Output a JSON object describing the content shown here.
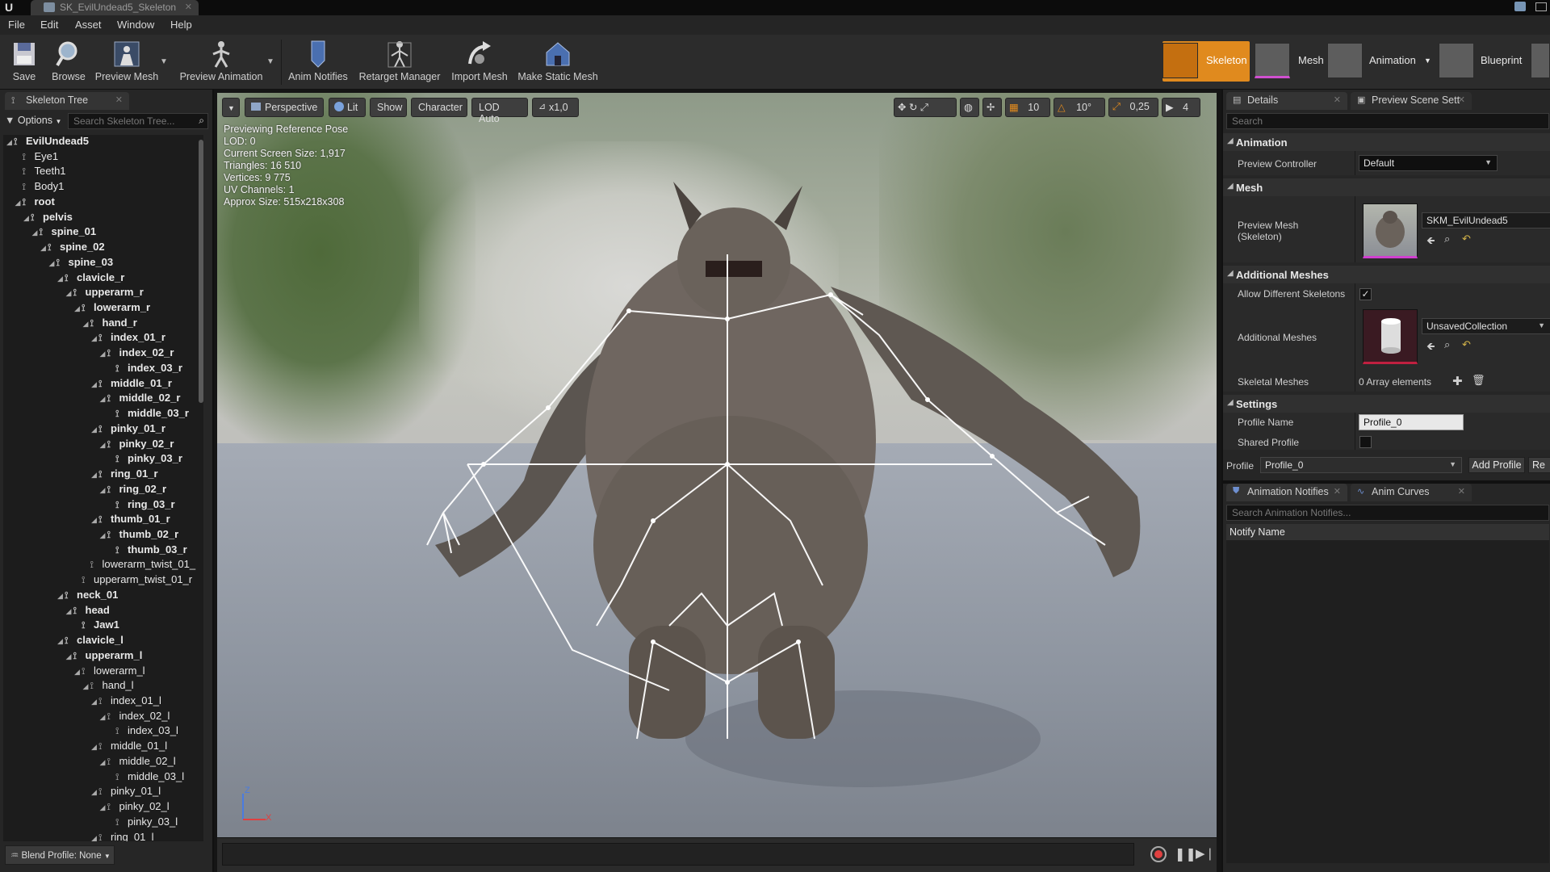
{
  "titlebar": {
    "logo": "U",
    "doc_tab": "SK_EvilUndead5_Skeleton"
  },
  "menu": [
    "File",
    "Edit",
    "Asset",
    "Window",
    "Help"
  ],
  "toolbar": {
    "save": "Save",
    "browse": "Browse",
    "preview_mesh": "Preview Mesh",
    "preview_animation": "Preview Animation",
    "anim_notifies": "Anim Notifies",
    "retarget_manager": "Retarget Manager",
    "import_mesh": "Import Mesh",
    "make_static_mesh": "Make Static Mesh"
  },
  "modes": {
    "skeleton": "Skeleton",
    "mesh": "Mesh",
    "animation": "Animation",
    "blueprint": "Blueprint"
  },
  "skeleton_tree": {
    "tab": "Skeleton Tree",
    "options": "Options",
    "search_placeholder": "Search Skeleton Tree...",
    "bones": [
      {
        "name": "EvilUndead5",
        "depth": 0,
        "bold": true,
        "exp": true
      },
      {
        "name": "Eye1",
        "depth": 1,
        "bold": false,
        "exp": false
      },
      {
        "name": "Teeth1",
        "depth": 1,
        "bold": false,
        "exp": false
      },
      {
        "name": "Body1",
        "depth": 1,
        "bold": false,
        "exp": false
      },
      {
        "name": "root",
        "depth": 1,
        "bold": true,
        "exp": true
      },
      {
        "name": "pelvis",
        "depth": 2,
        "bold": true,
        "exp": true
      },
      {
        "name": "spine_01",
        "depth": 3,
        "bold": true,
        "exp": true
      },
      {
        "name": "spine_02",
        "depth": 4,
        "bold": true,
        "exp": true
      },
      {
        "name": "spine_03",
        "depth": 5,
        "bold": true,
        "exp": true
      },
      {
        "name": "clavicle_r",
        "depth": 6,
        "bold": true,
        "exp": true
      },
      {
        "name": "upperarm_r",
        "depth": 7,
        "bold": true,
        "exp": true
      },
      {
        "name": "lowerarm_r",
        "depth": 8,
        "bold": true,
        "exp": true
      },
      {
        "name": "hand_r",
        "depth": 9,
        "bold": true,
        "exp": true
      },
      {
        "name": "index_01_r",
        "depth": 10,
        "bold": true,
        "exp": true
      },
      {
        "name": "index_02_r",
        "depth": 11,
        "bold": true,
        "exp": true
      },
      {
        "name": "index_03_r",
        "depth": 12,
        "bold": true,
        "exp": false
      },
      {
        "name": "middle_01_r",
        "depth": 10,
        "bold": true,
        "exp": true
      },
      {
        "name": "middle_02_r",
        "depth": 11,
        "bold": true,
        "exp": true
      },
      {
        "name": "middle_03_r",
        "depth": 12,
        "bold": true,
        "exp": false
      },
      {
        "name": "pinky_01_r",
        "depth": 10,
        "bold": true,
        "exp": true
      },
      {
        "name": "pinky_02_r",
        "depth": 11,
        "bold": true,
        "exp": true
      },
      {
        "name": "pinky_03_r",
        "depth": 12,
        "bold": true,
        "exp": false
      },
      {
        "name": "ring_01_r",
        "depth": 10,
        "bold": true,
        "exp": true
      },
      {
        "name": "ring_02_r",
        "depth": 11,
        "bold": true,
        "exp": true
      },
      {
        "name": "ring_03_r",
        "depth": 12,
        "bold": true,
        "exp": false
      },
      {
        "name": "thumb_01_r",
        "depth": 10,
        "bold": true,
        "exp": true
      },
      {
        "name": "thumb_02_r",
        "depth": 11,
        "bold": true,
        "exp": true
      },
      {
        "name": "thumb_03_r",
        "depth": 12,
        "bold": true,
        "exp": false
      },
      {
        "name": "lowerarm_twist_01_",
        "depth": 9,
        "bold": false,
        "exp": false
      },
      {
        "name": "upperarm_twist_01_r",
        "depth": 8,
        "bold": false,
        "exp": false
      },
      {
        "name": "neck_01",
        "depth": 6,
        "bold": true,
        "exp": true
      },
      {
        "name": "head",
        "depth": 7,
        "bold": true,
        "exp": true
      },
      {
        "name": "Jaw1",
        "depth": 8,
        "bold": true,
        "exp": false
      },
      {
        "name": "clavicle_l",
        "depth": 6,
        "bold": true,
        "exp": true
      },
      {
        "name": "upperarm_l",
        "depth": 7,
        "bold": true,
        "exp": true
      },
      {
        "name": "lowerarm_l",
        "depth": 8,
        "bold": false,
        "exp": true
      },
      {
        "name": "hand_l",
        "depth": 9,
        "bold": false,
        "exp": true
      },
      {
        "name": "index_01_l",
        "depth": 10,
        "bold": false,
        "exp": true
      },
      {
        "name": "index_02_l",
        "depth": 11,
        "bold": false,
        "exp": true
      },
      {
        "name": "index_03_l",
        "depth": 12,
        "bold": false,
        "exp": false
      },
      {
        "name": "middle_01_l",
        "depth": 10,
        "bold": false,
        "exp": true
      },
      {
        "name": "middle_02_l",
        "depth": 11,
        "bold": false,
        "exp": true
      },
      {
        "name": "middle_03_l",
        "depth": 12,
        "bold": false,
        "exp": false
      },
      {
        "name": "pinky_01_l",
        "depth": 10,
        "bold": false,
        "exp": true
      },
      {
        "name": "pinky_02_l",
        "depth": 11,
        "bold": false,
        "exp": true
      },
      {
        "name": "pinky_03_l",
        "depth": 12,
        "bold": false,
        "exp": false
      },
      {
        "name": "ring_01_l",
        "depth": 10,
        "bold": false,
        "exp": true
      }
    ],
    "blend_profile": "Blend Profile: None"
  },
  "viewport": {
    "perspective": "Perspective",
    "lit": "Lit",
    "show": "Show",
    "character": "Character",
    "lod_auto": "LOD Auto",
    "speed": "x1,0",
    "grid_snap": "10",
    "rot_snap": "10°",
    "scale_snap": "0,25",
    "cam_speed": "4",
    "stats": [
      "Previewing Reference Pose",
      "LOD: 0",
      "Current Screen Size: 1,917",
      "Triangles: 16 510",
      "Vertices: 9 775",
      "UV Channels: 1",
      "Approx Size: 515x218x308"
    ],
    "axis_z": "Z",
    "axis_x": "X"
  },
  "details": {
    "tab_details": "Details",
    "tab_scene": "Preview Scene Sett",
    "search_placeholder": "Search",
    "sec_animation": "Animation",
    "preview_controller_label": "Preview Controller",
    "preview_controller_value": "Default",
    "sec_mesh": "Mesh",
    "preview_mesh_label": "Preview Mesh\n(Skeleton)",
    "preview_mesh_value": "SKM_EvilUndead5",
    "sec_additional": "Additional Meshes",
    "allow_diff_label": "Allow Different Skeletons",
    "additional_meshes_label": "Additional Meshes",
    "additional_meshes_value": "UnsavedCollection",
    "skeletal_meshes_label": "Skeletal Meshes",
    "skeletal_meshes_value": "0 Array elements",
    "sec_settings": "Settings",
    "profile_name_label": "Profile Name",
    "profile_name_value": "Profile_0",
    "shared_profile_label": "Shared Profile",
    "profile_label": "Profile",
    "profile_value": "Profile_0",
    "add_profile": "Add Profile",
    "remove_profile": "Re"
  },
  "notifies": {
    "tab_notifies": "Animation Notifies",
    "tab_curves": "Anim Curves",
    "search_placeholder": "Search Animation Notifies...",
    "column": "Notify Name"
  },
  "colors": {
    "accent": "#e08a1e",
    "panel": "#262626",
    "viewport_sky": "#b9bcb3"
  }
}
